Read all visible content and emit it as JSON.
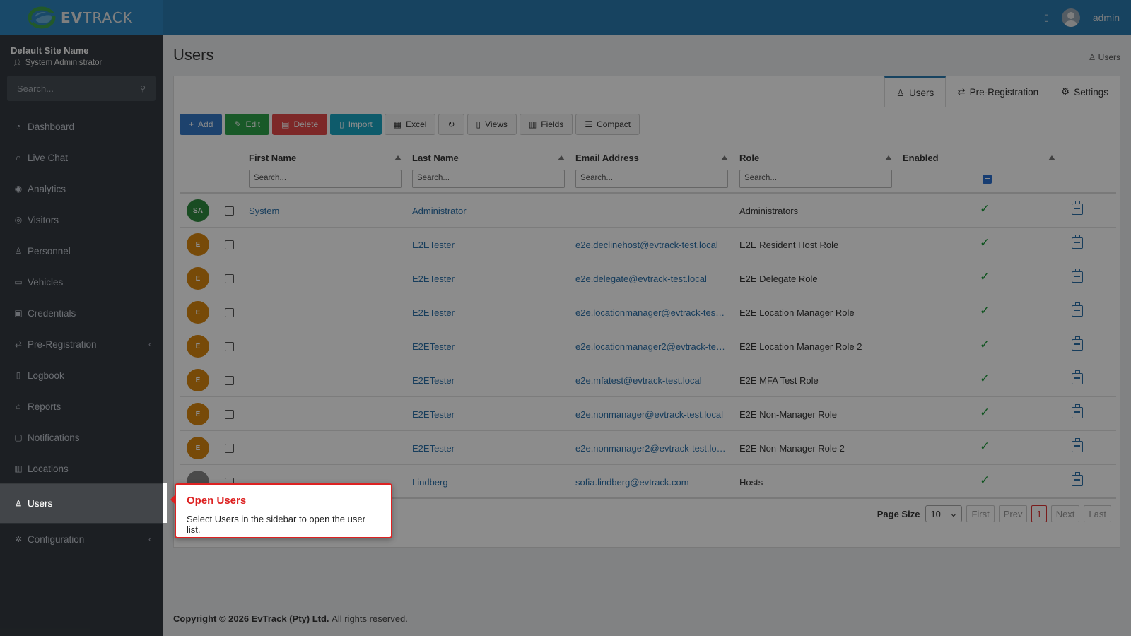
{
  "app": {
    "logo_text_bold": "EV",
    "logo_text": "TRACK",
    "user": "admin"
  },
  "sidebar": {
    "site_name": "Default Site Name",
    "site_role": "System Administrator",
    "search_placeholder": "Search...",
    "items": [
      {
        "label": "Dashboard",
        "icon": "dashboard-icon"
      },
      {
        "label": "Live Chat",
        "icon": "headset-icon"
      },
      {
        "label": "Analytics",
        "icon": "target-icon"
      },
      {
        "label": "Visitors",
        "icon": "eye-icon"
      },
      {
        "label": "Personnel",
        "icon": "user-tie-icon"
      },
      {
        "label": "Vehicles",
        "icon": "car-icon"
      },
      {
        "label": "Credentials",
        "icon": "id-badge-icon"
      },
      {
        "label": "Pre-Registration",
        "icon": "exchange-icon"
      },
      {
        "label": "Logbook",
        "icon": "book-icon"
      },
      {
        "label": "Reports",
        "icon": "chart-icon"
      },
      {
        "label": "Notifications",
        "icon": "bell-icon"
      },
      {
        "label": "Locations",
        "icon": "building-icon"
      },
      {
        "label": "Users",
        "icon": "users-icon"
      },
      {
        "label": "Configuration",
        "icon": "cog-icon"
      }
    ]
  },
  "page": {
    "title": "Users",
    "breadcrumb": "Users"
  },
  "tabs": [
    "Users",
    "Pre-Registration",
    "Settings"
  ],
  "toolbar": {
    "add": "Add",
    "edit": "Edit",
    "delete": "Delete",
    "import": "Import",
    "excel": "Excel",
    "views": "Views",
    "fields": "Fields",
    "compact": "Compact"
  },
  "table": {
    "columns": [
      "First Name",
      "Last Name",
      "Email Address",
      "Role",
      "Enabled"
    ],
    "search_placeholder": "Search...",
    "rows": [
      {
        "initials": "SA",
        "avatar_color": "#2e8b3e",
        "first": "System",
        "last": "Administrator",
        "email": "",
        "role": "Administrators",
        "enabled": true
      },
      {
        "initials": "E",
        "avatar_color": "#d9870f",
        "first": "",
        "last": "E2ETester",
        "email": "e2e.declinehost@evtrack-test.local",
        "role": "E2E Resident Host Role",
        "enabled": true
      },
      {
        "initials": "E",
        "avatar_color": "#d9870f",
        "first": "",
        "last": "E2ETester",
        "email": "e2e.delegate@evtrack-test.local",
        "role": "E2E Delegate Role",
        "enabled": true
      },
      {
        "initials": "E",
        "avatar_color": "#d9870f",
        "first": "",
        "last": "E2ETester",
        "email": "e2e.locationmanager@evtrack-tes…",
        "role": "E2E Location Manager Role",
        "enabled": true
      },
      {
        "initials": "E",
        "avatar_color": "#d9870f",
        "first": "",
        "last": "E2ETester",
        "email": "e2e.locationmanager2@evtrack-te…",
        "role": "E2E Location Manager Role 2",
        "enabled": true
      },
      {
        "initials": "E",
        "avatar_color": "#d9870f",
        "first": "",
        "last": "E2ETester",
        "email": "e2e.mfatest@evtrack-test.local",
        "role": "E2E MFA Test Role",
        "enabled": true
      },
      {
        "initials": "E",
        "avatar_color": "#d9870f",
        "first": "",
        "last": "E2ETester",
        "email": "e2e.nonmanager@evtrack-test.local",
        "role": "E2E Non-Manager Role",
        "enabled": true
      },
      {
        "initials": "E",
        "avatar_color": "#d9870f",
        "first": "",
        "last": "E2ETester",
        "email": "e2e.nonmanager2@evtrack-test.lo…",
        "role": "E2E Non-Manager Role 2",
        "enabled": true
      },
      {
        "initials": "",
        "avatar_color": "#888888",
        "first": "",
        "last": "Lindberg",
        "email": "sofia.lindberg@evtrack.com",
        "role": "Hosts",
        "enabled": true
      }
    ]
  },
  "pager": {
    "label": "Page Size",
    "size": "10",
    "first": "First",
    "prev": "Prev",
    "current": "1",
    "next": "Next",
    "last": "Last"
  },
  "footer": {
    "prefix": "Copyright © 2026",
    "company": "EvTrack (Pty) Ltd.",
    "suffix": "All rights reserved."
  },
  "tooltip": {
    "title": "Open Users",
    "body": "Select Users in the sidebar to open the user list."
  }
}
